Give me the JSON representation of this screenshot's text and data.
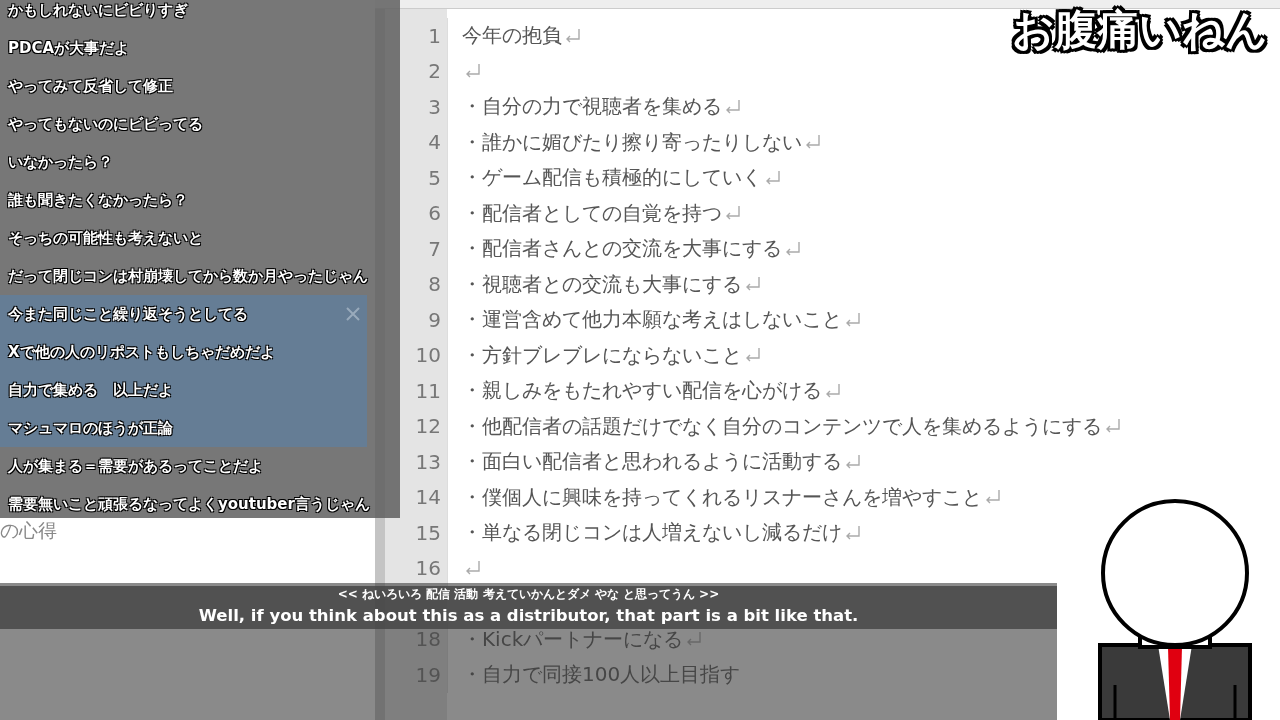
{
  "stream_title": "お腹痛いねん",
  "file_list": {
    "visible_entry": "の心得"
  },
  "editor": {
    "lines": [
      {
        "number": "1",
        "text": "今年の抱負",
        "newline_mark": true
      },
      {
        "number": "2",
        "newline_mark": true
      },
      {
        "number": "3",
        "text": "・自分の力で視聴者を集める",
        "newline_mark": true
      },
      {
        "number": "4",
        "text": "・誰かに媚びたり擦り寄ったりしない",
        "newline_mark": true
      },
      {
        "number": "5",
        "text": "・ゲーム配信も積極的にしていく",
        "newline_mark": true
      },
      {
        "number": "6",
        "text": "・配信者としての自覚を持つ",
        "newline_mark": true
      },
      {
        "number": "7",
        "text": "・配信者さんとの交流を大事にする",
        "newline_mark": true
      },
      {
        "number": "8",
        "text": "・視聴者との交流も大事にする",
        "newline_mark": true
      },
      {
        "number": "9",
        "text": "・運営含めて他力本願な考えはしないこと",
        "newline_mark": true
      },
      {
        "number": "10",
        "text": "・方針ブレブレにならないこと",
        "newline_mark": true
      },
      {
        "number": "11",
        "text": "・親しみをもたれやすい配信を心がける",
        "newline_mark": true
      },
      {
        "number": "12",
        "text": "・他配信者の話題だけでなく自分のコンテンツで人を集めるようにする",
        "newline_mark": true
      },
      {
        "number": "13",
        "text": "・面白い配信者と思われるように活動する",
        "newline_mark": true
      },
      {
        "number": "14",
        "text": "・僕個人に興味を持ってくれるリスナーさんを増やすこと",
        "newline_mark": true
      },
      {
        "number": "15",
        "text": "・単なる閉じコンは人増えないし減るだけ",
        "newline_mark": true
      },
      {
        "number": "16",
        "newline_mark": true
      }
    ],
    "lines_below_subtitle": [
      {
        "number": "18",
        "text": "・Kickパートナーになる",
        "newline_mark": true
      },
      {
        "number": "19",
        "text": "・自力で同接100人以上目指す",
        "newline_mark": false
      }
    ]
  },
  "comments": [
    {
      "text": "かもしれないにビビりすぎ",
      "selected": false
    },
    {
      "text": "PDCAが大事だよ",
      "selected": false
    },
    {
      "text": "やってみて反省して修正",
      "selected": false
    },
    {
      "text": "やってもないのにビビってる",
      "selected": false
    },
    {
      "text": "いなかったら？",
      "selected": false
    },
    {
      "text": "誰も聞きたくなかったら？",
      "selected": false
    },
    {
      "text": "そっちの可能性も考えないと",
      "selected": false
    },
    {
      "text": "だって閉じコンは村崩壊してから数か月やったじゃん",
      "selected": false
    },
    {
      "text": "今また同じこと繰り返そうとしてる",
      "selected": true
    },
    {
      "text": "Xで他の人のリポストもしちゃだめだよ",
      "selected": true
    },
    {
      "text": "自力で集める　以上だよ",
      "selected": true
    },
    {
      "text": "マシュマロのほうが正論",
      "selected": true
    },
    {
      "text": "人が集まる＝需要があるってことだよ",
      "selected": false
    },
    {
      "text": "需要無いこと頑張るなってよくyoutuber言うじゃん",
      "selected": false
    }
  ],
  "subtitle": {
    "original": "<< ねいろいろ 配信 活動 考えていかんとダメ やな と思ってうん >>",
    "translation": "Well, if you think about this as a distributor, that part is a bit like that."
  }
}
